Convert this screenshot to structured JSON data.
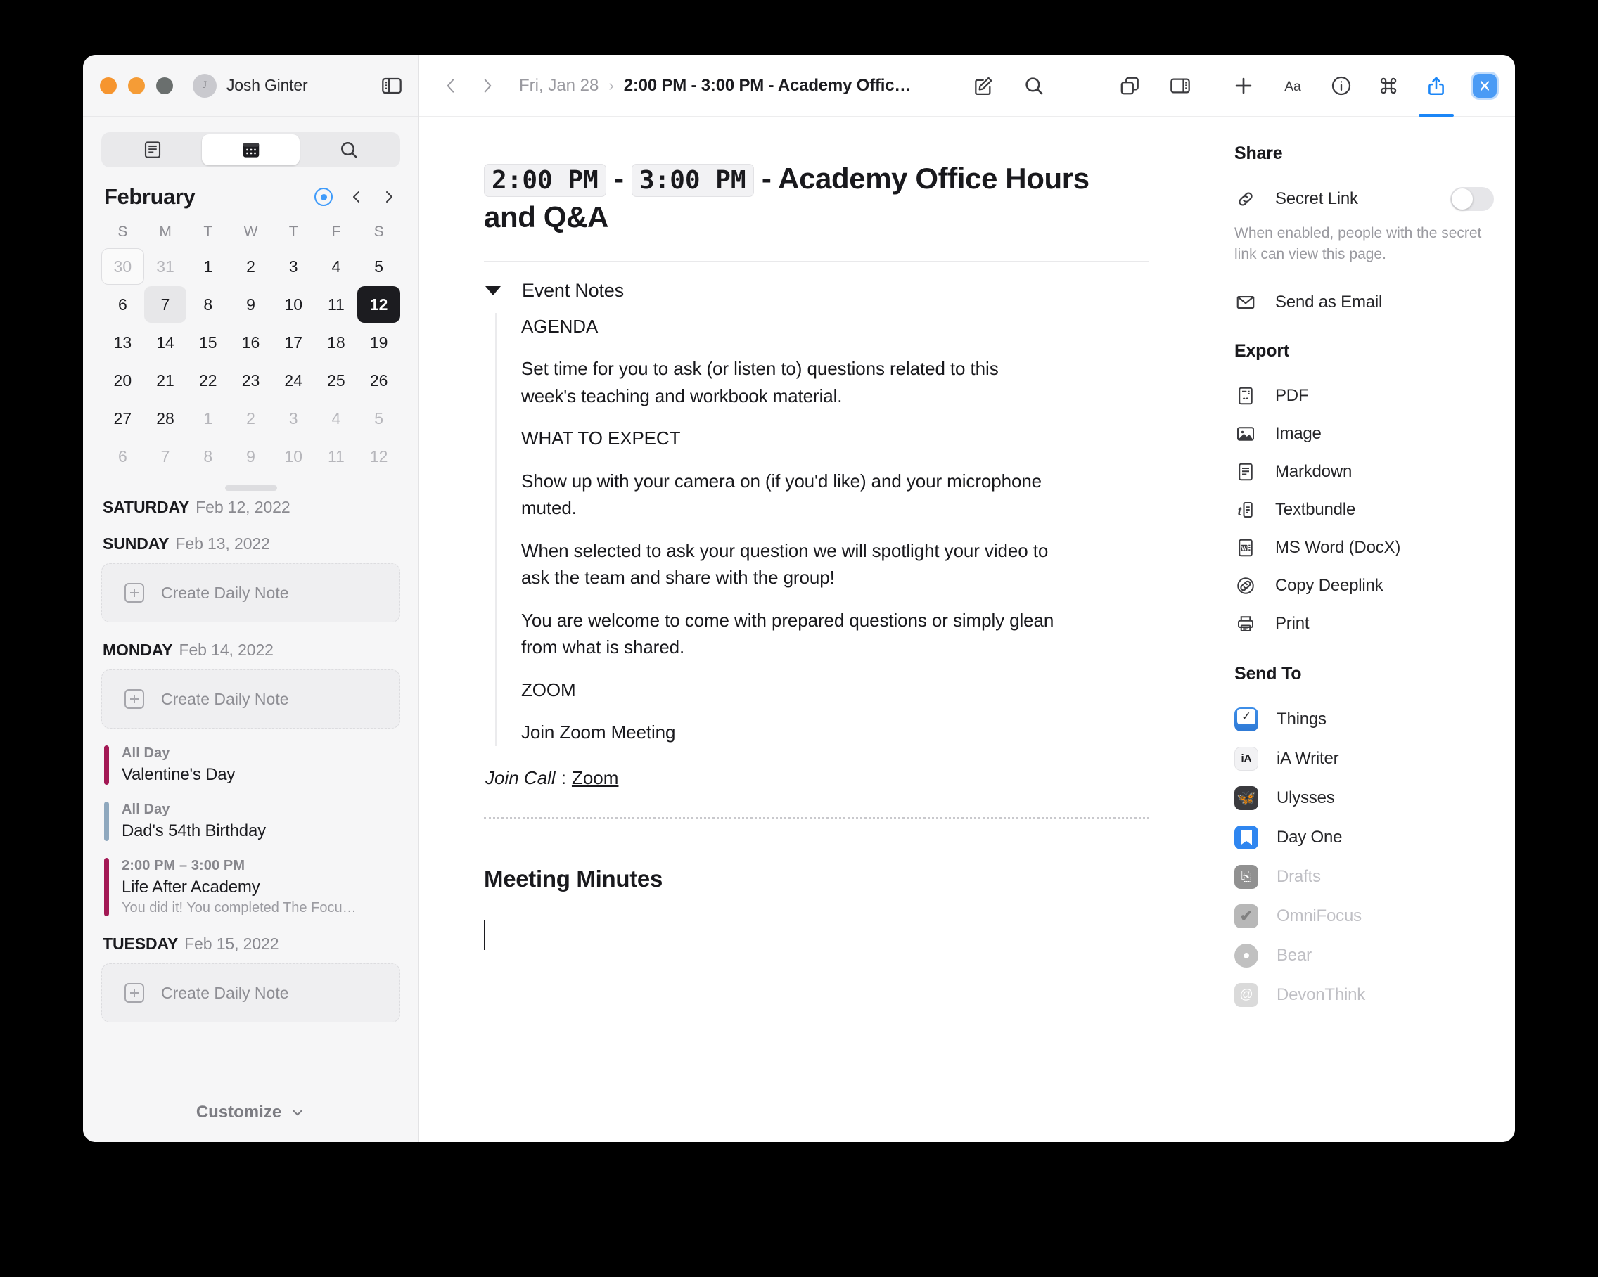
{
  "window": {
    "traffic_lights": [
      "close",
      "minimize",
      "zoom"
    ],
    "user": {
      "initial": "J",
      "name": "Josh Ginter"
    }
  },
  "sidebar": {
    "segments": [
      {
        "icon": "notes-list-icon",
        "label": "Notes",
        "active": false
      },
      {
        "icon": "calendar-icon",
        "label": "Calendar",
        "active": true
      },
      {
        "icon": "search-icon",
        "label": "Search",
        "active": false
      }
    ],
    "calendar": {
      "month": "February",
      "dow": [
        "S",
        "M",
        "T",
        "W",
        "T",
        "F",
        "S"
      ],
      "weeks": [
        [
          {
            "d": "30",
            "state": "outline"
          },
          {
            "d": "31",
            "state": "muted"
          },
          {
            "d": "1",
            "state": ""
          },
          {
            "d": "2",
            "state": ""
          },
          {
            "d": "3",
            "state": ""
          },
          {
            "d": "4",
            "state": ""
          },
          {
            "d": "5",
            "state": ""
          }
        ],
        [
          {
            "d": "6",
            "state": ""
          },
          {
            "d": "7",
            "state": "hl"
          },
          {
            "d": "8",
            "state": ""
          },
          {
            "d": "9",
            "state": ""
          },
          {
            "d": "10",
            "state": ""
          },
          {
            "d": "11",
            "state": ""
          },
          {
            "d": "12",
            "state": "sel"
          }
        ],
        [
          {
            "d": "13",
            "state": ""
          },
          {
            "d": "14",
            "state": ""
          },
          {
            "d": "15",
            "state": ""
          },
          {
            "d": "16",
            "state": ""
          },
          {
            "d": "17",
            "state": ""
          },
          {
            "d": "18",
            "state": ""
          },
          {
            "d": "19",
            "state": ""
          }
        ],
        [
          {
            "d": "20",
            "state": ""
          },
          {
            "d": "21",
            "state": ""
          },
          {
            "d": "22",
            "state": ""
          },
          {
            "d": "23",
            "state": ""
          },
          {
            "d": "24",
            "state": ""
          },
          {
            "d": "25",
            "state": ""
          },
          {
            "d": "26",
            "state": ""
          }
        ],
        [
          {
            "d": "27",
            "state": ""
          },
          {
            "d": "28",
            "state": ""
          },
          {
            "d": "1",
            "state": "muted"
          },
          {
            "d": "2",
            "state": "muted"
          },
          {
            "d": "3",
            "state": "muted"
          },
          {
            "d": "4",
            "state": "muted"
          },
          {
            "d": "5",
            "state": "muted"
          }
        ],
        [
          {
            "d": "6",
            "state": "muted"
          },
          {
            "d": "7",
            "state": "muted"
          },
          {
            "d": "8",
            "state": "muted"
          },
          {
            "d": "9",
            "state": "muted"
          },
          {
            "d": "10",
            "state": "muted"
          },
          {
            "d": "11",
            "state": "muted"
          },
          {
            "d": "12",
            "state": "muted"
          }
        ]
      ]
    },
    "agenda": {
      "clipped_day": {
        "weekday": "SATURDAY",
        "date": "Feb 12, 2022"
      },
      "days": [
        {
          "weekday": "SUNDAY",
          "date": "Feb 13, 2022",
          "create_note": "Create Daily Note",
          "events": []
        },
        {
          "weekday": "MONDAY",
          "date": "Feb 14, 2022",
          "create_note": "Create Daily Note",
          "events": [
            {
              "time": "All Day",
              "title": "Valentine's Day",
              "sub": "",
              "color": "#A31955"
            },
            {
              "time": "All Day",
              "title": "Dad's 54th Birthday",
              "sub": "",
              "color": "#8FA8BE"
            },
            {
              "time": "2:00 PM – 3:00 PM",
              "title": "Life After Academy",
              "sub": "You did it! You completed The Focu…",
              "color": "#A31955"
            }
          ]
        },
        {
          "weekday": "TUESDAY",
          "date": "Feb 15, 2022",
          "create_note": "Create Daily Note",
          "events": []
        }
      ]
    },
    "customize": {
      "label": "Customize",
      "icon": "chevron-down-icon"
    }
  },
  "main": {
    "breadcrumb": {
      "date": "Fri, Jan 28",
      "separator": "›",
      "title": "2:00 PM - 3:00 PM - Academy Offic…"
    },
    "toolbar": [
      {
        "icon": "compose-icon",
        "label": "New Note"
      },
      {
        "icon": "search-icon",
        "label": "Search"
      },
      {
        "icon": "duplicate-icon",
        "label": "Duplicate"
      },
      {
        "icon": "toggle-inspector-icon",
        "label": "Toggle Inspector"
      }
    ],
    "document": {
      "start_time": "2:00 PM",
      "dash": "-",
      "end_time": "3:00 PM",
      "title_rest": "- Academy Office Hours and Q&A",
      "notes_section_label": "Event Notes",
      "paragraphs": [
        "AGENDA",
        "Set time for you to ask (or listen to) questions related to this week's teaching and workbook material.",
        "WHAT TO EXPECT",
        "Show up with your camera on (if you'd like) and your microphone muted.",
        "When selected to ask your question we will spotlight your video to ask the team and share with the group!",
        "You are welcome to come with prepared questions or simply glean from what is shared.",
        "ZOOM",
        "Join Zoom Meeting"
      ],
      "join_call_label": "Join Call",
      "join_call_sep": ":",
      "join_call_link": "Zoom",
      "meeting_minutes_title": "Meeting Minutes"
    }
  },
  "inspector": {
    "tabs": [
      {
        "icon": "plus-icon",
        "active": false
      },
      {
        "icon": "text-format-icon",
        "active": false
      },
      {
        "icon": "info-icon",
        "active": false
      },
      {
        "icon": "command-icon",
        "active": false
      },
      {
        "icon": "share-icon",
        "active": true
      },
      {
        "icon": "app-extension-icon",
        "active": false
      }
    ],
    "share": {
      "heading": "Share",
      "secret_link": {
        "icon": "link-icon",
        "label": "Secret Link",
        "enabled": false
      },
      "hint": "When enabled, people with the secret link can view this page.",
      "send_as_email": {
        "icon": "envelope-icon",
        "label": "Send as Email"
      }
    },
    "export": {
      "heading": "Export",
      "items": [
        {
          "icon": "pdf-icon",
          "label": "PDF",
          "disabled": false
        },
        {
          "icon": "image-icon",
          "label": "Image",
          "disabled": false
        },
        {
          "icon": "markdown-icon",
          "label": "Markdown",
          "disabled": false
        },
        {
          "icon": "textbundle-icon",
          "label": "Textbundle",
          "disabled": false
        },
        {
          "icon": "word-icon",
          "label": "MS Word (DocX)",
          "disabled": false
        },
        {
          "icon": "deeplink-icon",
          "label": "Copy Deeplink",
          "disabled": false
        },
        {
          "icon": "printer-icon",
          "label": "Print",
          "disabled": false
        }
      ]
    },
    "send_to": {
      "heading": "Send To",
      "items": [
        {
          "icon": "things-app-icon",
          "label": "Things",
          "disabled": false
        },
        {
          "icon": "ia-writer-app-icon",
          "label": "iA Writer",
          "disabled": false
        },
        {
          "icon": "ulysses-app-icon",
          "label": "Ulysses",
          "disabled": false
        },
        {
          "icon": "day-one-app-icon",
          "label": "Day One",
          "disabled": false
        },
        {
          "icon": "drafts-app-icon",
          "label": "Drafts",
          "disabled": true
        },
        {
          "icon": "omnifocus-app-icon",
          "label": "OmniFocus",
          "disabled": true
        },
        {
          "icon": "bear-app-icon",
          "label": "Bear",
          "disabled": true
        },
        {
          "icon": "devonthink-app-icon",
          "label": "DevonThink",
          "disabled": true
        }
      ]
    }
  },
  "colors": {
    "accent_blue": "#1b86f7",
    "traffic_close": "#f6952f",
    "traffic_min": "#f59c36",
    "traffic_zoom": "#6a6f6e",
    "event_magenta": "#A31955",
    "event_blue_gray": "#8FA8BE"
  }
}
